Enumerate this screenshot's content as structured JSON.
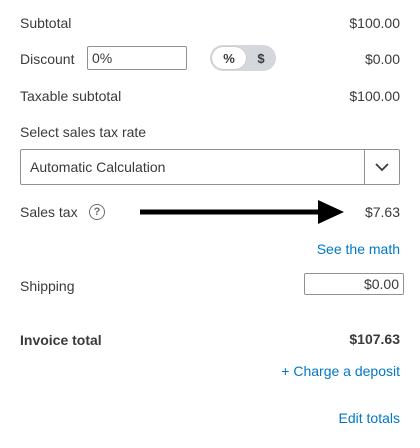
{
  "subtotal": {
    "label": "Subtotal",
    "amount": "$100.00"
  },
  "discount": {
    "label": "Discount",
    "input_value": "0%",
    "toggle_percent": "%",
    "toggle_dollar": "$",
    "amount": "$0.00"
  },
  "taxable_subtotal": {
    "label": "Taxable subtotal",
    "amount": "$100.00"
  },
  "tax_rate": {
    "label": "Select sales tax rate",
    "selected": "Automatic Calculation"
  },
  "sales_tax": {
    "label": "Sales tax",
    "help_icon": "?",
    "amount": "$7.63",
    "see_math_link": "See the math"
  },
  "shipping": {
    "label": "Shipping",
    "input_value": "$0.00"
  },
  "invoice_total": {
    "label": "Invoice total",
    "amount": "$107.63"
  },
  "links": {
    "charge_deposit": "+ Charge a deposit",
    "edit_totals": "Edit totals"
  },
  "colors": {
    "text": "#393a3d",
    "link": "#0077c5",
    "border": "#8d9096",
    "toggle_bg": "#d4d7dc"
  }
}
